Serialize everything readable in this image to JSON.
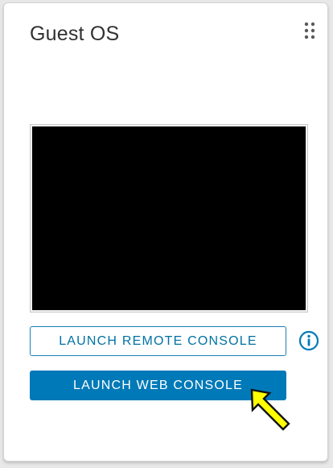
{
  "card": {
    "title": "Guest OS"
  },
  "icons": {
    "drag_handle": "drag-handle-icon",
    "info": "info-icon",
    "pointer": "arrow-pointer-icon"
  },
  "actions": {
    "launch_remote_console_label": "LAUNCH REMOTE CONSOLE",
    "launch_web_console_label": "LAUNCH WEB CONSOLE"
  },
  "colors": {
    "primary": "#0079b8",
    "outline": "#1a7fb5",
    "console_bg": "#000000",
    "highlight_arrow": "#ffff00"
  }
}
